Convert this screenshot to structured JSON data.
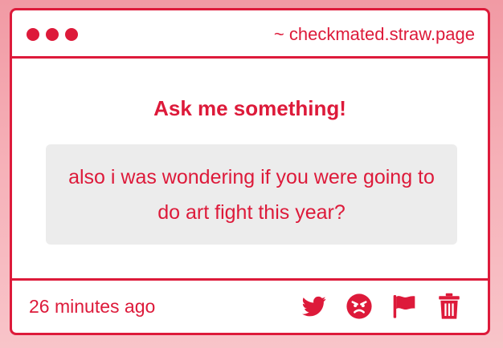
{
  "window": {
    "url": "~ checkmated.straw.page"
  },
  "main": {
    "heading": "Ask me something!",
    "question": "also i was wondering if you were going to do art fight this year?"
  },
  "footer": {
    "timestamp": "26 minutes ago",
    "actions": [
      {
        "icon": "twitter-icon"
      },
      {
        "icon": "angry-face-icon"
      },
      {
        "icon": "flag-icon"
      },
      {
        "icon": "trash-icon"
      }
    ]
  },
  "colors": {
    "accent": "#dd1a3a",
    "panel": "#ececec",
    "background": "#f4a6af"
  }
}
